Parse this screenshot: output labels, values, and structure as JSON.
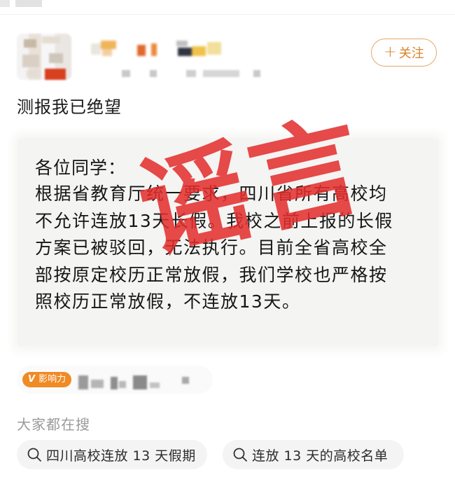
{
  "header": {
    "follow_label": "关注"
  },
  "post": {
    "title": "测报我已绝望"
  },
  "notice": {
    "greeting": "各位同学：",
    "lines": [
      "根据省教育厅统一要求，四川省所有高校均",
      "不允许连放13天长假。我校之前上报的长假",
      "方案已被驳回，无法执行。目前全省高校全",
      "部按原定校历正常放假，我们学校也严格按",
      "照校历正常放假，不连放13天。"
    ]
  },
  "stamp": {
    "text": "谣言",
    "color": "#e22c2c"
  },
  "badge": {
    "v": "V",
    "label": "影响力",
    "color": "#f08a24"
  },
  "search": {
    "heading": "大家都在搜",
    "chips": [
      {
        "icon": "search-icon",
        "label": "四川高校连放 13 天假期"
      },
      {
        "icon": "search-icon",
        "label": "连放 13 天的高校名单"
      }
    ]
  },
  "colors": {
    "follow_accent": "#d9822b",
    "chip_bg": "#f4f4f4"
  }
}
